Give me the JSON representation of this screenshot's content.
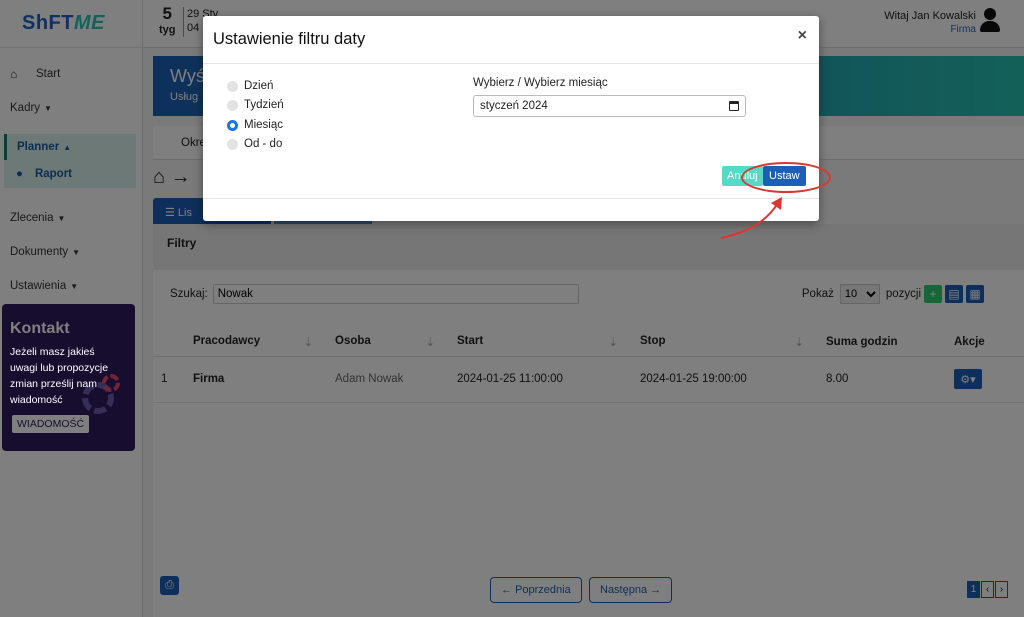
{
  "app": {
    "logo_part1": "ShFT",
    "logo_part2": "ME"
  },
  "topbar": {
    "week_num": "5",
    "week_label": "tyg",
    "date_line1": "29 Sty",
    "date_line2": "04",
    "greeting": "Witaj Jan Kowalski",
    "company": "Firma"
  },
  "sidebar": {
    "start": "Start",
    "kadry": "Kadry",
    "planner": "Planner",
    "raport": "Raport",
    "zlecenia": "Zlecenia",
    "dokumenty": "Dokumenty",
    "ustawienia": "Ustawienia"
  },
  "contact": {
    "title": "Kontakt",
    "text": "Jeżeli masz jakieś uwagi lub propozycje zmian prześlij nam wiadomość",
    "button": "WIADOMOŚĆ"
  },
  "banner": {
    "title": "Wyś",
    "subtitle": "Usług"
  },
  "tabbar": {
    "item": "Okre"
  },
  "list_tab": "Lis",
  "panel": {
    "filters_title": "Filtry",
    "search_label": "Szukaj:",
    "search_value": "Nowak",
    "show_label": "Pokaż",
    "show_value": "10",
    "show_suffix": "pozycji"
  },
  "table": {
    "headers": [
      "Pracodawcy",
      "Osoba",
      "Start",
      "Stop",
      "Suma godzin",
      "Akcje"
    ],
    "rows": [
      [
        "1",
        "Firma",
        "Adam Nowak",
        "2024-01-25 11:00:00",
        "2024-01-25 19:00:00",
        "8.00"
      ]
    ]
  },
  "pagination": {
    "prev": "Poprzednia",
    "next": "Następna",
    "page": "1"
  },
  "modal": {
    "title": "Ustawienie filtru daty",
    "close": "×",
    "options": [
      "Dzień",
      "Tydzień",
      "Miesiąc",
      "Od - do"
    ],
    "selected_option": "Miesiąc",
    "field_label": "Wybierz / Wybierz miesiąc",
    "field_value": "styczeń 2024",
    "cancel": "Anuluj",
    "submit": "Ustaw"
  },
  "colors": {
    "primary": "#1d5fb8",
    "accent": "#27c1b2",
    "highlight": "#e0342f"
  }
}
